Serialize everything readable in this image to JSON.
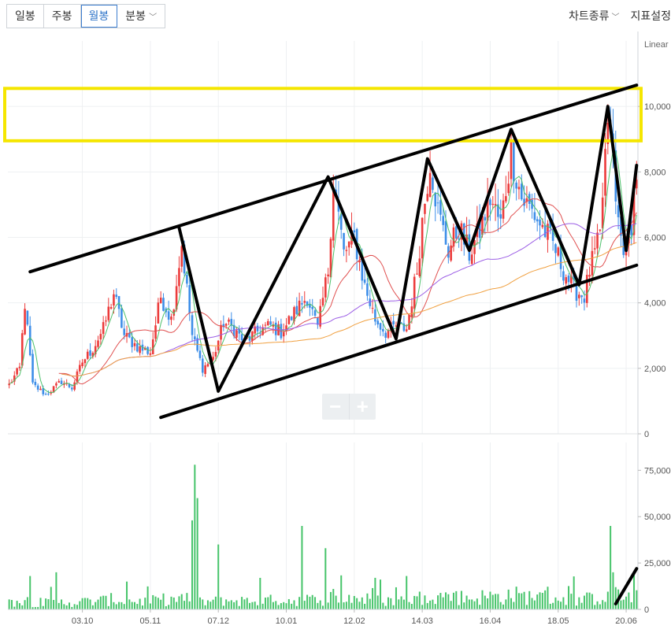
{
  "toolbar": {
    "tabs": [
      {
        "label": "일봉",
        "active": false
      },
      {
        "label": "주봉",
        "active": false
      },
      {
        "label": "월봉",
        "active": true
      },
      {
        "label": "분봉",
        "active": false
      }
    ],
    "chart_type_label": "차트종류",
    "indicator_label": "지표설정"
  },
  "zoom": {
    "minus": "−",
    "plus": "+"
  },
  "colors": {
    "up": "#ec3b3b",
    "down": "#3d8ee8",
    "volume": "#46c46a",
    "ma_short": "#4cc06a",
    "ma_mid": "#e05050",
    "ma_long": "#9b5de5",
    "ma_longest": "#f0a040",
    "highlight_box": "#f5e600",
    "trendline": "#000000"
  },
  "chart_data": {
    "type": "candlestick",
    "price_scale_label": "Linear",
    "price_ylim": [
      0,
      12000
    ],
    "price_ticks": [
      "0",
      "2,000",
      "4,000",
      "6,000",
      "8,000",
      "10,000"
    ],
    "volume_ylim": [
      0,
      90000
    ],
    "volume_ticks": [
      "0",
      "25,000,0",
      "50,000,0",
      "75,000,0"
    ],
    "x_labels": [
      "03.10",
      "05.11",
      "07.12",
      "10.01",
      "12.02",
      "14.03",
      "16.04",
      "18.05",
      "20.06"
    ],
    "price_anchors": [
      [
        0,
        1500
      ],
      [
        4,
        2000
      ],
      [
        6,
        4000
      ],
      [
        9,
        1500
      ],
      [
        14,
        1200
      ],
      [
        20,
        1600
      ],
      [
        24,
        1400
      ],
      [
        28,
        2200
      ],
      [
        32,
        2600
      ],
      [
        36,
        3200
      ],
      [
        40,
        4300
      ],
      [
        44,
        3000
      ],
      [
        50,
        2600
      ],
      [
        54,
        2500
      ],
      [
        58,
        4200
      ],
      [
        62,
        3500
      ],
      [
        66,
        5800
      ],
      [
        70,
        3000
      ],
      [
        74,
        2000
      ],
      [
        78,
        2300
      ],
      [
        82,
        3400
      ],
      [
        86,
        3200
      ],
      [
        90,
        2800
      ],
      [
        96,
        3200
      ],
      [
        100,
        3300
      ],
      [
        104,
        3100
      ],
      [
        110,
        3800
      ],
      [
        114,
        4200
      ],
      [
        118,
        3200
      ],
      [
        122,
        5000
      ],
      [
        124,
        7800
      ],
      [
        128,
        5500
      ],
      [
        132,
        6000
      ],
      [
        136,
        4500
      ],
      [
        140,
        3500
      ],
      [
        144,
        3100
      ],
      [
        148,
        3300
      ],
      [
        152,
        3200
      ],
      [
        156,
        5000
      ],
      [
        158,
        6500
      ],
      [
        161,
        8400
      ],
      [
        164,
        6800
      ],
      [
        168,
        5600
      ],
      [
        172,
        6300
      ],
      [
        176,
        5500
      ],
      [
        180,
        6200
      ],
      [
        184,
        7200
      ],
      [
        188,
        6400
      ],
      [
        192,
        8600
      ],
      [
        196,
        7200
      ],
      [
        200,
        6800
      ],
      [
        204,
        6300
      ],
      [
        208,
        5800
      ],
      [
        212,
        5000
      ],
      [
        216,
        4400
      ],
      [
        220,
        4200
      ],
      [
        222,
        5000
      ],
      [
        226,
        6000
      ],
      [
        228,
        8500
      ],
      [
        230,
        9500
      ],
      [
        232,
        7000
      ],
      [
        234,
        6000
      ],
      [
        236,
        5600
      ],
      [
        238,
        6500
      ],
      [
        240,
        8000
      ]
    ],
    "volume_spikes": [
      [
        8,
        18000
      ],
      [
        18,
        20000
      ],
      [
        45,
        15000
      ],
      [
        70,
        48000
      ],
      [
        71,
        78000
      ],
      [
        72,
        60000
      ],
      [
        80,
        35000
      ],
      [
        96,
        17000
      ],
      [
        112,
        45000
      ],
      [
        121,
        33000
      ],
      [
        152,
        18000
      ],
      [
        230,
        45000
      ],
      [
        231,
        20000
      ],
      [
        232,
        12000
      ]
    ],
    "ma_periods": [
      5,
      20,
      60,
      120
    ],
    "annotations": {
      "highlight_box_price": [
        8950,
        10550
      ],
      "upper_channel": [
        [
          8,
          4950
        ],
        [
          240,
          10650
        ]
      ],
      "lower_channel": [
        [
          58,
          500
        ],
        [
          240,
          5150
        ]
      ],
      "zigzag": [
        [
          65,
          6300
        ],
        [
          80,
          1300
        ],
        [
          122,
          7850
        ],
        [
          148,
          2900
        ],
        [
          160,
          8400
        ],
        [
          176,
          5600
        ],
        [
          192,
          9300
        ],
        [
          218,
          4550
        ],
        [
          229,
          10000
        ],
        [
          236,
          5600
        ],
        [
          240,
          8200
        ]
      ],
      "volume_stroke": [
        [
          232,
          3000
        ],
        [
          240,
          22000
        ]
      ]
    }
  }
}
